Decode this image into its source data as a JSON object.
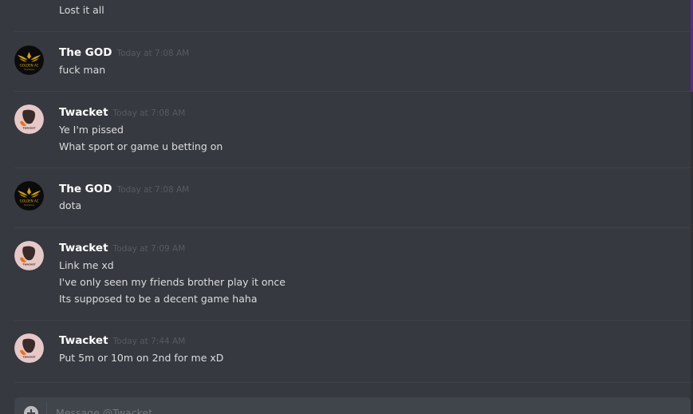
{
  "messages": [
    {
      "type": "continuation",
      "lines": [
        "Lost it all"
      ]
    },
    {
      "author": "The GOD",
      "avatar_icon": "golden-ac-logo-avatar",
      "timestamp": "Today at 7:08 AM",
      "lines": [
        "fuck man"
      ]
    },
    {
      "author": "Twacket",
      "avatar_icon": "twacket-avatar",
      "timestamp": "Today at 7:08 AM",
      "lines": [
        "Ye I'm pissed",
        "What sport or game u betting on"
      ]
    },
    {
      "author": "The GOD",
      "avatar_icon": "golden-ac-logo-avatar",
      "timestamp": "Today at 7:08 AM",
      "lines": [
        "dota"
      ]
    },
    {
      "author": "Twacket",
      "avatar_icon": "twacket-avatar",
      "timestamp": "Today at 7:09 AM",
      "lines": [
        "Link me xd",
        "I've only seen my friends brother play it once",
        "Its supposed to be a decent game haha"
      ]
    },
    {
      "author": "Twacket",
      "avatar_icon": "twacket-avatar",
      "timestamp": "Today at 7:44 AM",
      "lines": [
        "Put 5m or 10m on 2nd for me xD"
      ]
    }
  ],
  "input": {
    "placeholder": "Message @Twacket",
    "value": ""
  },
  "avatar_logo_text": "GOLDEN AC",
  "avatar_logo_subtext": "Chambers",
  "avatar_twacket_text": "TWACKET",
  "colors": {
    "background": "#36393f",
    "username": "#ffffff",
    "message_text": "#dcddde",
    "timestamp": "#575a60",
    "input_bg": "#40444b",
    "gold": "#d4a017"
  }
}
